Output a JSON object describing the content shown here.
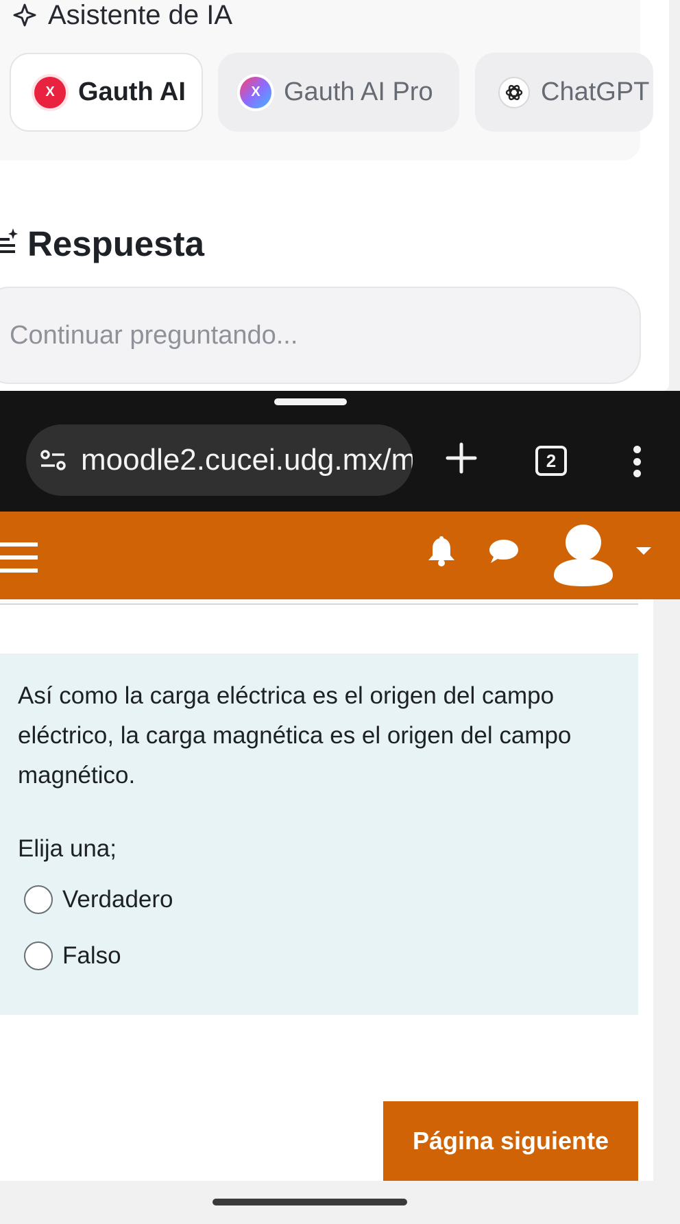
{
  "assistant": {
    "title": "Asistente de IA",
    "models": [
      {
        "label": "Gauth AI",
        "logo": "X",
        "selected": true
      },
      {
        "label": "Gauth AI Pro",
        "logo": "X",
        "selected": false
      },
      {
        "label": "ChatGPT",
        "logo": "",
        "selected": false
      }
    ]
  },
  "answer": {
    "heading": "Respuesta",
    "input_placeholder": "Continuar preguntando..."
  },
  "browser": {
    "url": "moodle2.cucei.udg.mx/m",
    "tab_count": "2",
    "icons": [
      "tune-icon",
      "plus-icon",
      "tabs-icon",
      "more-vert-icon"
    ]
  },
  "moodle": {
    "header_color": "#cf6306",
    "icons": [
      "hamburger-icon",
      "bell-icon",
      "chat-icon",
      "user-avatar-icon",
      "caret-down-icon"
    ],
    "question": {
      "text": "Así como la carga eléctrica es el origen del campo eléctrico, la carga magnética es el origen del campo magnético.",
      "prompt": "Elija una;",
      "options": [
        {
          "label": "Verdadero",
          "checked": false
        },
        {
          "label": "Falso",
          "checked": false
        }
      ]
    },
    "next_button": "Página siguiente"
  }
}
